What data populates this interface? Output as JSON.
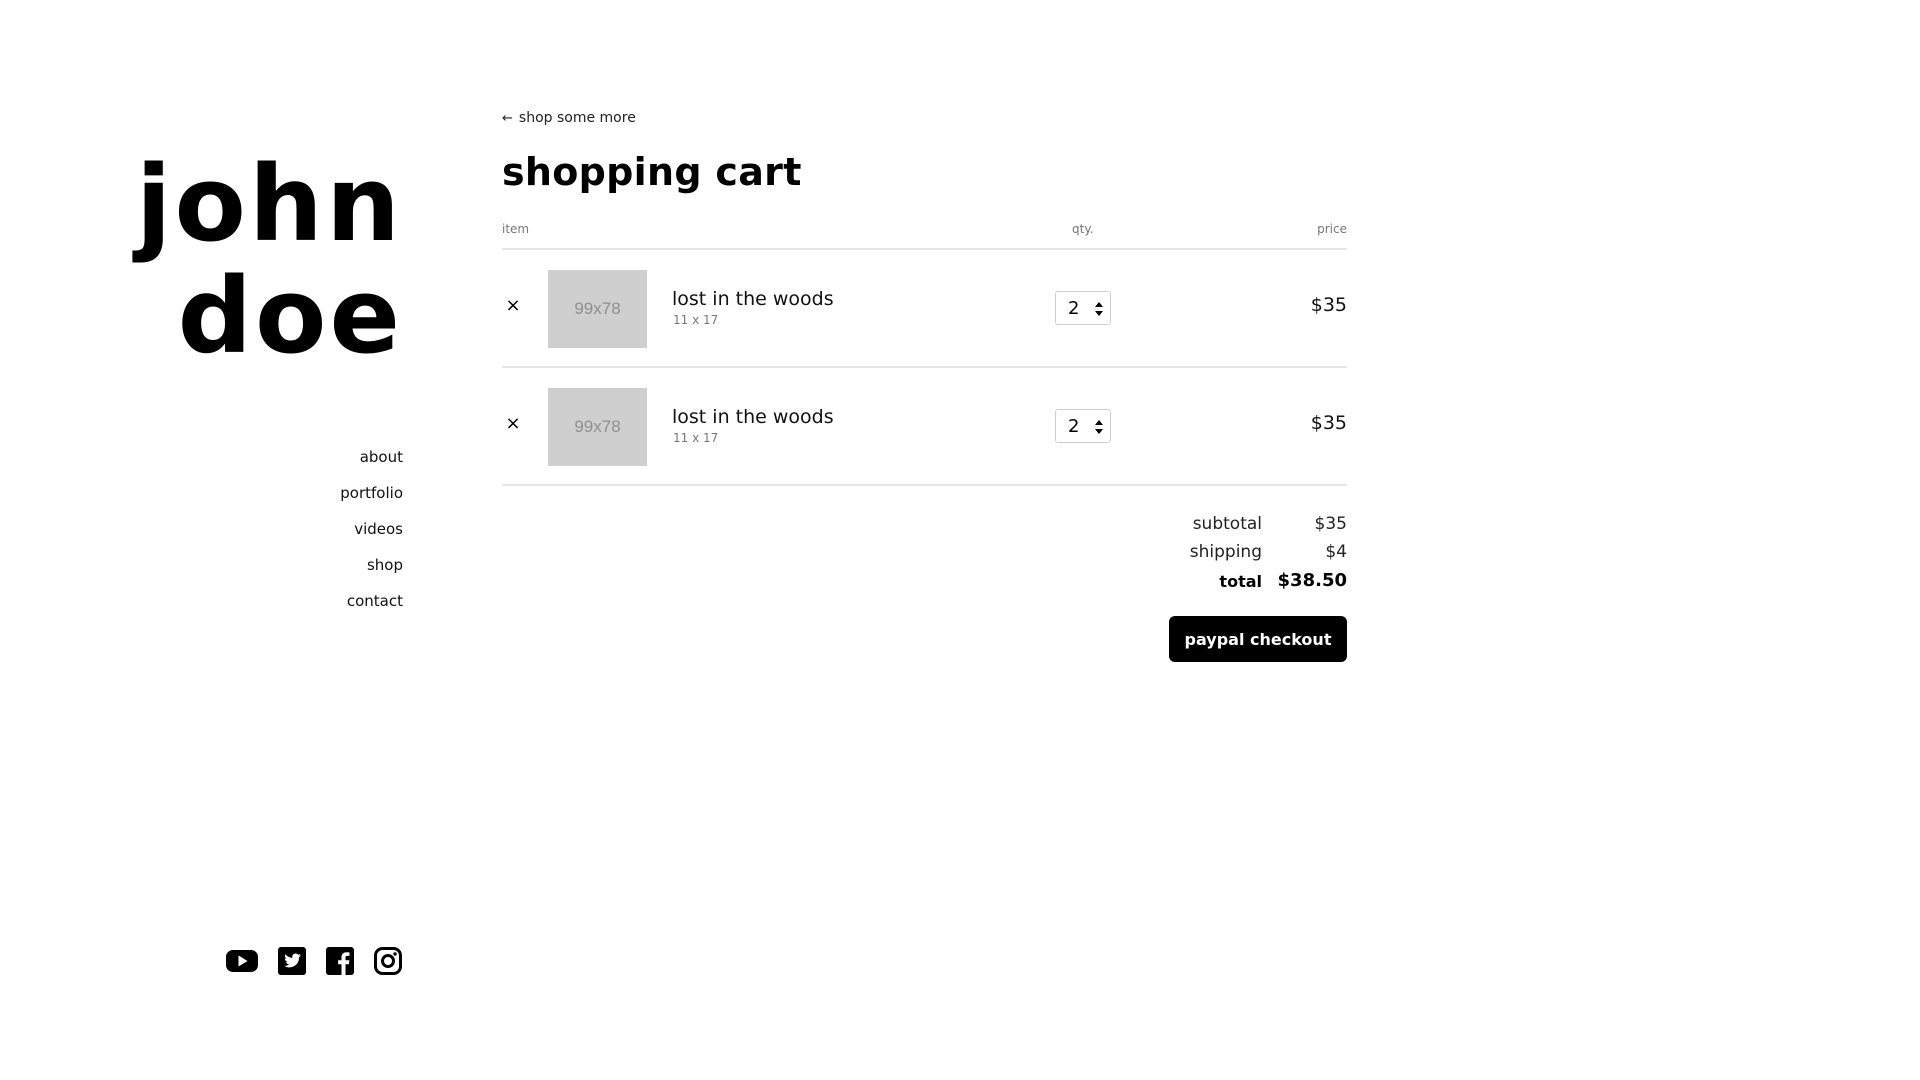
{
  "brand": {
    "line1": "john",
    "line2": "doe"
  },
  "nav": {
    "items": [
      {
        "label": "about"
      },
      {
        "label": "portfolio"
      },
      {
        "label": "videos"
      },
      {
        "label": "shop"
      },
      {
        "label": "contact"
      }
    ]
  },
  "social": [
    "youtube-icon",
    "twitter-icon",
    "facebook-icon",
    "instagram-icon"
  ],
  "back_link": {
    "label": "shop some more"
  },
  "cart": {
    "title": "shopping cart",
    "headers": {
      "item": "item",
      "qty": "qty.",
      "price": "price"
    },
    "items": [
      {
        "thumb": "99x78",
        "name": "lost in the woods",
        "size": "11 x 17",
        "qty": "2",
        "price": "$35"
      },
      {
        "thumb": "99x78",
        "name": "lost in the woods",
        "size": "11 x 17",
        "qty": "2",
        "price": "$35"
      }
    ],
    "remove_symbol": "×"
  },
  "totals": {
    "subtotal_label": "subtotal",
    "subtotal": "$35",
    "shipping_label": "shipping",
    "shipping": "$4",
    "total_label": "total",
    "total": "$38.50"
  },
  "checkout": {
    "label": "paypal checkout"
  },
  "colors": {
    "thumb_bg": "#cfcfcf",
    "button_bg": "#000000",
    "divider": "#e6e6e6"
  }
}
